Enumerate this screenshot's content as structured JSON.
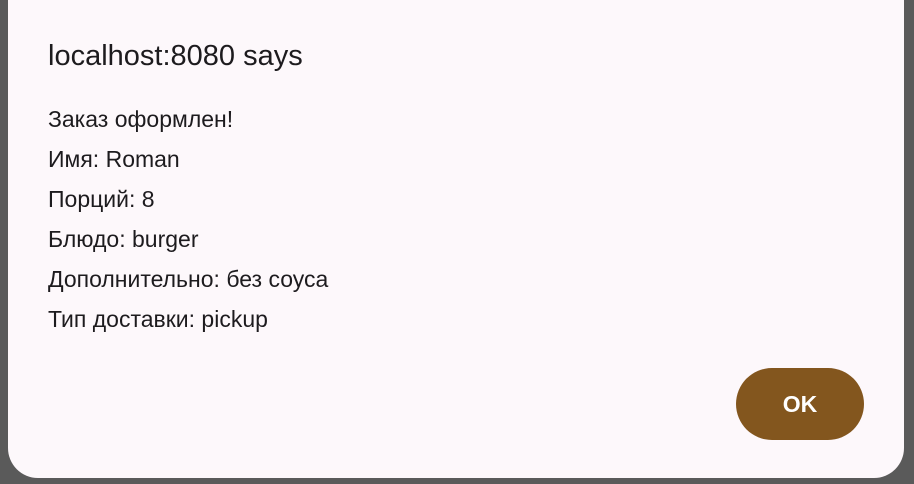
{
  "dialog": {
    "title": "localhost:8080 says",
    "message_lines": [
      "Заказ оформлен!",
      "Имя: Roman",
      "Порций: 8",
      "Блюдо: burger",
      "Дополнительно: без соуса",
      "Тип доставки: pickup"
    ],
    "ok_label": "OK"
  },
  "colors": {
    "dialog_background": "#fdf8fb",
    "button_background": "#83561e",
    "button_text": "#ffffff",
    "text": "#1d1b1e",
    "backdrop": "#5a5a5a"
  }
}
